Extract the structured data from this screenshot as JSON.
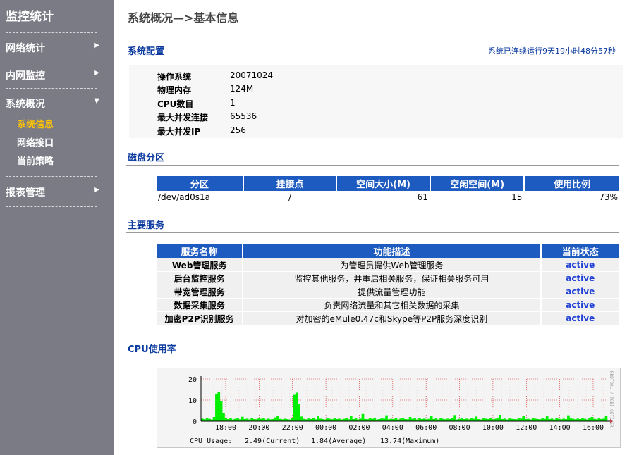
{
  "sidebar": {
    "title": "监控统计",
    "items": [
      {
        "label": "网络统计",
        "arrow": "▶"
      },
      {
        "label": "内网监控",
        "arrow": "▶"
      },
      {
        "label": "系统概况",
        "arrow": "▼",
        "sub": [
          {
            "label": "系统信息",
            "active": true
          },
          {
            "label": "网络接口",
            "active": false
          },
          {
            "label": "当前策略",
            "active": false
          }
        ]
      },
      {
        "label": "报表管理",
        "arrow": "▶"
      }
    ]
  },
  "page": {
    "title": "系统概况—>基本信息",
    "uptime": "系统已连续运行9天19小时48分57秒"
  },
  "system_config": {
    "heading": "系统配置",
    "rows": [
      {
        "key": "操作系统",
        "value": "20071024"
      },
      {
        "key": "物理内存",
        "value": "124M"
      },
      {
        "key": "CPU数目",
        "value": "1"
      },
      {
        "key": "最大并发连接",
        "value": "65536"
      },
      {
        "key": "最大并发IP",
        "value": "256"
      }
    ]
  },
  "disk": {
    "heading": "磁盘分区",
    "columns": [
      "分区",
      "挂接点",
      "空间大小(M)",
      "空闲空间(M)",
      "使用比例"
    ],
    "rows": [
      [
        "/dev/ad0s1a",
        "/",
        "61",
        "15",
        "73%"
      ]
    ]
  },
  "services": {
    "heading": "主要服务",
    "columns": [
      "服务名称",
      "功能描述",
      "当前状态"
    ],
    "rows": [
      [
        "Web管理服务",
        "为管理员提供Web管理服务",
        "active"
      ],
      [
        "后台监控服务",
        "监控其他服务，并重启相关服务，保证相关服务可用",
        "active"
      ],
      [
        "带宽管理服务",
        "提供流量管理功能",
        "active"
      ],
      [
        "数据采集服务",
        "负责网络流量和其它相关数据的采集",
        "active"
      ],
      [
        "加密P2P识别服务",
        "对加密的eMule0.47c和Skype等P2P服务深度识别",
        "active"
      ]
    ]
  },
  "cpu": {
    "heading": "CPU使用率",
    "side_label": "RRDTOOL / TOBI OETIKER",
    "legend_label": "CPU Usage:",
    "current": "2.49(Current)",
    "average": "1.84(Average)",
    "maximum": "13.74(Maximum)",
    "chart_data": {
      "type": "area",
      "ylim": [
        0,
        20
      ],
      "y_ticks": [
        0,
        10,
        20
      ],
      "x_ticks": [
        "18:00",
        "20:00",
        "22:00",
        "00:00",
        "02:00",
        "04:00",
        "06:00",
        "08:00",
        "10:00",
        "12:00",
        "14:00",
        "16:00"
      ],
      "grid": true,
      "colors": {
        "fill": "#00ee00",
        "grid": "#d02020",
        "axis": "#000000"
      },
      "series": [
        {
          "values": [
            1.2,
            0.9,
            1.5,
            1.1,
            0.8,
            2.0,
            12.8,
            13.74,
            9.5,
            4.0,
            1.6,
            1.0,
            1.3,
            0.8,
            1.1,
            1.4,
            0.9,
            2.1,
            1.0,
            1.2,
            0.8,
            1.5,
            1.0,
            0.9,
            1.3,
            1.1,
            1.6,
            0.8,
            1.2,
            0.9,
            1.0,
            1.8,
            2.5,
            1.1,
            0.9,
            1.2,
            1.0,
            0.8,
            1.4,
            12.5,
            13.5,
            8.0,
            2.2,
            1.1,
            0.9,
            1.3,
            1.0,
            1.5,
            0.9,
            2.3,
            1.2,
            1.0,
            0.8,
            1.4,
            1.1,
            0.9,
            1.6,
            1.0,
            1.2,
            0.8,
            1.1,
            1.5,
            0.9,
            2.6,
            1.0,
            1.3,
            0.8,
            1.2,
            3.4,
            1.0,
            0.9,
            1.4,
            1.1,
            1.6,
            0.8,
            1.0,
            1.3,
            1.2,
            2.8,
            0.9,
            1.1,
            1.0,
            1.5,
            0.8,
            1.2,
            1.4,
            1.0,
            0.9,
            2.0,
            1.1,
            1.3,
            0.8,
            1.6,
            1.0,
            1.2,
            0.9,
            1.1,
            2.4,
            1.0,
            1.3,
            0.8,
            1.5,
            1.1,
            0.9,
            1.2,
            1.0,
            1.4,
            2.9,
            0.8,
            1.1,
            1.3,
            1.0,
            1.2,
            0.9,
            1.5,
            1.1,
            2.2,
            1.0,
            0.8,
            1.3,
            1.2,
            1.0,
            1.6,
            0.9,
            1.1,
            1.4,
            3.0,
            1.0,
            1.2,
            0.8,
            1.3,
            1.1,
            1.0,
            0.9,
            1.5,
            1.2,
            2.6,
            1.0,
            1.1,
            0.8,
            1.4,
            1.2,
            1.0,
            0.9,
            1.3,
            1.1,
            2.3,
            1.0,
            1.2,
            0.8,
            1.5,
            1.1,
            0.9,
            1.2,
            1.0,
            2.8,
            1.3,
            1.1,
            0.9,
            1.2,
            1.0,
            1.4,
            1.1,
            0.8,
            1.6,
            2.0,
            1.1,
            0.9,
            1.3,
            1.0,
            1.2,
            2.49
          ]
        }
      ]
    }
  }
}
